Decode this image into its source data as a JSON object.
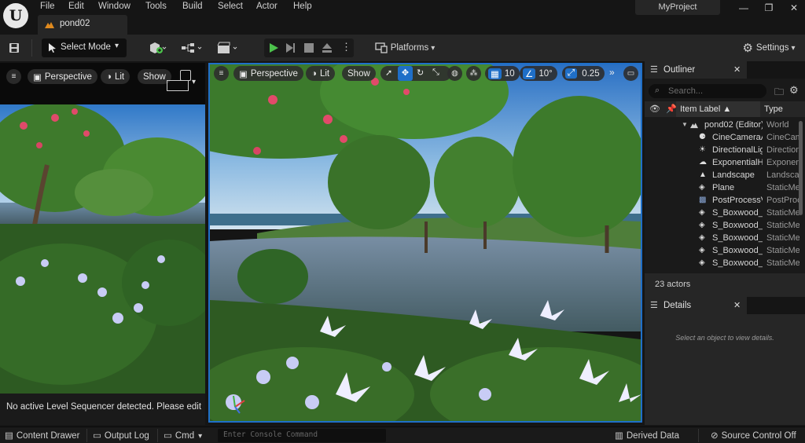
{
  "menu": [
    "File",
    "Edit",
    "Window",
    "Tools",
    "Build",
    "Select",
    "Actor",
    "Help"
  ],
  "document_tab": "pond02",
  "project_name": "MyProject",
  "toolbar": {
    "select_mode": "Select Mode",
    "platforms": "Platforms",
    "settings": "Settings"
  },
  "left_viewport": {
    "perspective": "Perspective",
    "lit": "Lit",
    "show": "Show",
    "message": "No active Level Sequencer detected. Please edit a"
  },
  "main_viewport": {
    "perspective": "Perspective",
    "lit": "Lit",
    "show": "Show",
    "grid_snap": "10",
    "rotation_snap": "10°",
    "scale_snap": "0.25"
  },
  "outliner": {
    "tab": "Outliner",
    "search_placeholder": "Search...",
    "col_label": "Item Label ▲",
    "col_type": "Type",
    "root": {
      "name": "pond02 (Editor)",
      "type": "World"
    },
    "items": [
      {
        "name": "CineCameraActor",
        "type": "CineCameraActor",
        "icon": "camera-icon"
      },
      {
        "name": "DirectionalLight",
        "type": "DirectionalLight",
        "icon": "light-icon"
      },
      {
        "name": "ExponentialHeightFog",
        "type": "ExponentialHeightFog",
        "icon": "fog-icon"
      },
      {
        "name": "Landscape",
        "type": "Landscape",
        "icon": "landscape-icon"
      },
      {
        "name": "Plane",
        "type": "StaticMeshActor",
        "icon": "mesh-icon"
      },
      {
        "name": "PostProcessVolume",
        "type": "PostProcessVolume",
        "icon": "volume-icon"
      },
      {
        "name": "S_Boxwood_",
        "type": "StaticMeshActor",
        "icon": "mesh-icon"
      },
      {
        "name": "S_Boxwood_",
        "type": "StaticMeshActor",
        "icon": "mesh-icon"
      },
      {
        "name": "S_Boxwood_",
        "type": "StaticMeshActor",
        "icon": "mesh-icon"
      },
      {
        "name": "S_Boxwood_",
        "type": "StaticMeshActor",
        "icon": "mesh-icon"
      },
      {
        "name": "S_Boxwood_",
        "type": "StaticMeshActor",
        "icon": "mesh-icon"
      }
    ],
    "actor_count": "23 actors"
  },
  "details": {
    "tab": "Details",
    "empty_message": "Select an object to view details."
  },
  "bottom_bar": {
    "content_drawer": "Content Drawer",
    "output_log": "Output Log",
    "cmd": "Cmd",
    "console_placeholder": "Enter Console Command",
    "derived_data": "Derived Data",
    "source_control": "Source Control Off"
  },
  "colors": {
    "accent_blue": "#1f6fc8",
    "play_green": "#4cc24c",
    "panel_bg": "#1a1a1a",
    "toolbar_bg": "#262626"
  }
}
